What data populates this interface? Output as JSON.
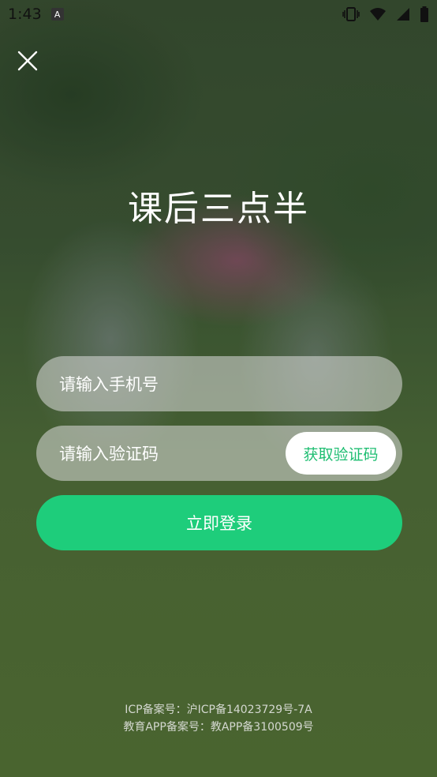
{
  "status_bar": {
    "time": "1:43",
    "notification_icon": "a-icon",
    "icons": [
      "vibrate-icon",
      "wifi-icon",
      "signal-icon",
      "battery-icon"
    ]
  },
  "app": {
    "title": "课后三点半"
  },
  "form": {
    "phone_placeholder": "请输入手机号",
    "code_placeholder": "请输入验证码",
    "get_code_label": "获取验证码",
    "login_label": "立即登录"
  },
  "footer": {
    "icp": "ICP备案号：沪ICP备14023729号-7A",
    "app_record": "教育APP备案号：教APP备3100509号"
  },
  "colors": {
    "accent": "#1ecd7b",
    "accent_text": "#1fbe72"
  }
}
